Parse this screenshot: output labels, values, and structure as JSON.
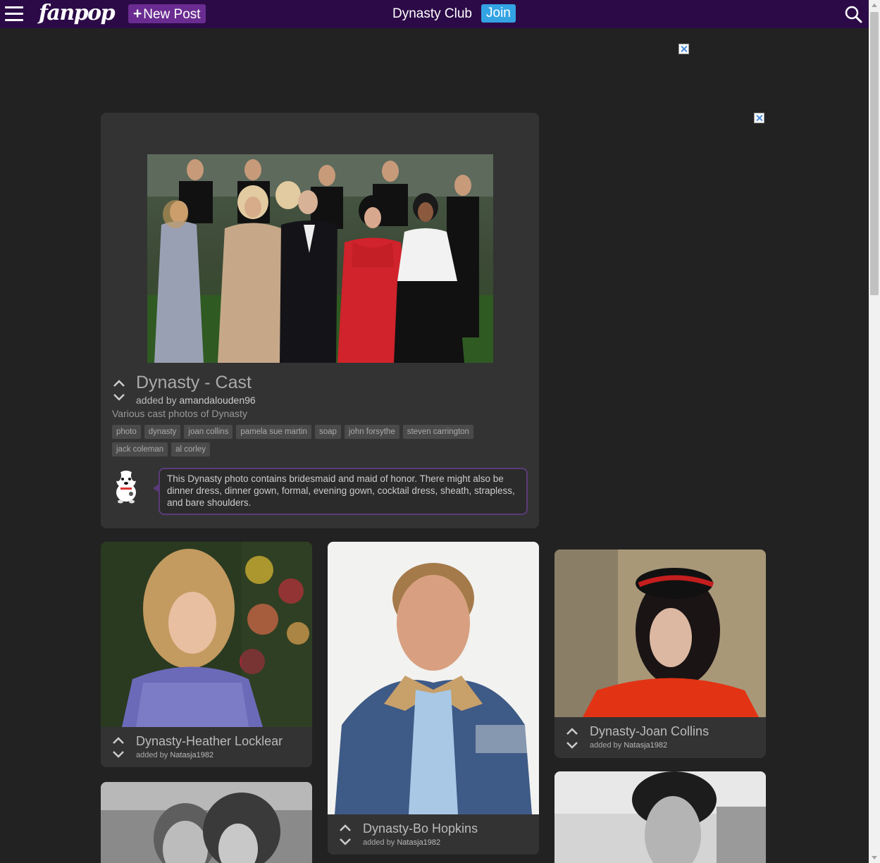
{
  "header": {
    "logo": "fanpop",
    "new_post_label": "New Post",
    "club_title": "Dynasty Club",
    "join_label": "Join"
  },
  "featured": {
    "title": "Dynasty - Cast",
    "added_by_prefix": "added by",
    "added_by_user": "amandalouden96",
    "description": "Various cast photos of Dynasty",
    "tags": [
      "photo",
      "dynasty",
      "joan collins",
      "pamela sue martin",
      "soap",
      "john forsythe",
      "steven carrington",
      "jack coleman",
      "al corley"
    ],
    "caption": "This Dynasty photo contains bridesmaid and maid of honor. There might also be dinner dress, dinner gown, formal, evening gown, cocktail dress, sheath, strapless, and bare shoulders."
  },
  "grid": [
    {
      "title": "Dynasty-Heather Locklear",
      "added_by_prefix": "added by",
      "user": "Natasja1982"
    },
    {
      "title": "Dynasty-Bo Hopkins",
      "added_by_prefix": "added by",
      "user": "Natasja1982"
    },
    {
      "title": "Dynasty-Joan Collins",
      "added_by_prefix": "added by",
      "user": "Natasja1982"
    }
  ],
  "colors": {
    "header_bg": "#2c0a47",
    "new_post_bg": "#6a2c91",
    "join_bg": "#33a3e4",
    "page_bg": "#222222",
    "card_bg": "#333333",
    "bubble_border": "#5b3b7a"
  },
  "icons": {
    "menu": "hamburger-icon",
    "search": "search-icon",
    "vote_up": "chevron-up-icon",
    "vote_down": "chevron-down-icon",
    "mascot": "dog-mascot-icon"
  }
}
